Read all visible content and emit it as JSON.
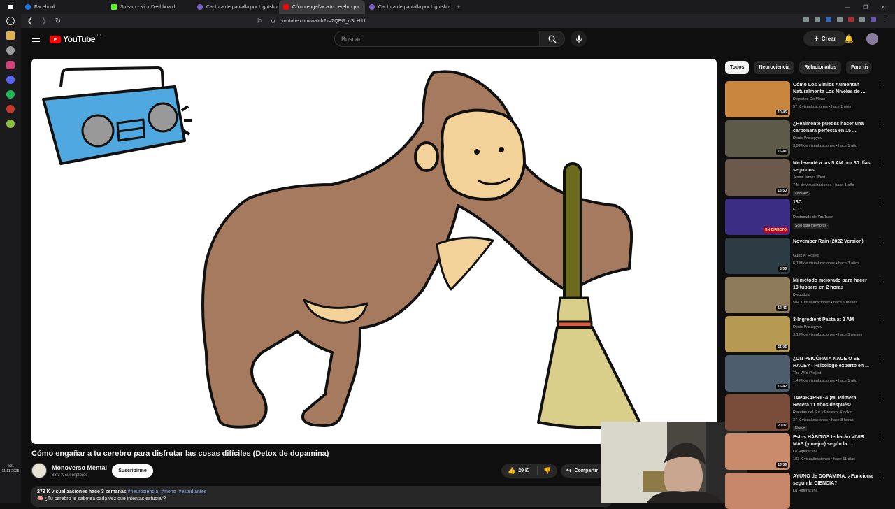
{
  "browser": {
    "tabs": [
      {
        "label": "Facebook",
        "color": "#1877f2"
      },
      {
        "label": "Stream - Kick Dashboard",
        "color": "#53fc18"
      },
      {
        "label": "Captura de pantalla por Lightshot",
        "color": "#7b61c9"
      },
      {
        "label": "Cómo engañar a tu cerebro p",
        "color": "#ff0000"
      },
      {
        "label": "Captura de pantalla por Lightshot",
        "color": "#7b61c9"
      }
    ],
    "url": "youtube.com/watch?v=ZQEG_uSLHIU",
    "new_tab": "+",
    "window_controls": [
      "—",
      "❐",
      "✕"
    ]
  },
  "system": {
    "time": "4:01",
    "date": "11-11-2025"
  },
  "youtube": {
    "logo_text": "YouTube",
    "country": "CL",
    "search_placeholder": "Buscar",
    "create_label": "Crear"
  },
  "video": {
    "title": "Cómo engañar a tu cerebro para disfrutar las cosas difíciles (Detox de dopamina)",
    "channel": "Monoverso Mental",
    "subscribers": "33,3 K suscriptores",
    "subscribe_label": "Suscribirme",
    "likes": "29 K",
    "share_label": "Compartir",
    "views_date": "273 K visualizaciones  hace 3 semanas",
    "hashtags": [
      "#neurociencia",
      "#mono",
      "#estudiantes"
    ],
    "desc_line": "🧠 ¿Tu cerebro te sabotea cada vez que intentas estudiar?"
  },
  "chips": [
    "Todos",
    "Neurociencia",
    "Relacionados",
    "Para ti"
  ],
  "recommendations": [
    {
      "title": "Cómo Los Simios Aumentan Naturalmente Los Niveles de ...",
      "channel": "Deportes De Mono",
      "meta": "57 K visualizaciones • hace 1 mes",
      "duration": "10:45",
      "thumb": "#c9863f"
    },
    {
      "title": "¿Realmente puedes hacer una carbonara perfecta en 15 ...",
      "channel": "Denis Prokopyev",
      "meta": "3,9 M de visualizaciones • hace 1 año",
      "duration": "15:41",
      "thumb": "#5d5a4a"
    },
    {
      "title": "Me levanté a las 5 AM por 30 días seguidos",
      "channel": "Jesse James West",
      "meta": "7 M de visualizaciones • hace 1 año",
      "duration": "18:50",
      "thumb": "#6b5a4c",
      "badge": "Doblado"
    },
    {
      "title": "13C",
      "channel": "El 13",
      "meta": "Destacado de YouTube",
      "duration": "EN DIRECTO",
      "thumb": "#3b2d84",
      "badge": "Solo para miembros"
    },
    {
      "title": "November Rain (2022 Version)",
      "channel": "Guns N' Roses",
      "meta": "6,7 M de visualizaciones • hace 3 años",
      "duration": "8:56",
      "thumb": "#2c3b44"
    },
    {
      "title": "Mi método mejorado para hacer 10 tuppers en 2 horas",
      "channel": "Diegodoal",
      "meta": "584 K visualizaciones • hace 6 meses",
      "duration": "12:46",
      "thumb": "#8d7b5c"
    },
    {
      "title": "3-Ingredient Pasta at 2 AM",
      "channel": "Denis Prokopyev",
      "meta": "3,1 M de visualizaciones • hace 5 meses",
      "duration": "11:05",
      "thumb": "#b69a52"
    },
    {
      "title": "¿UN PSICÓPATA NACE O SE HACE? - Psicólogo experto en ...",
      "channel": "The Wild Project",
      "meta": "1,4 M de visualizaciones • hace 1 año",
      "duration": "16:42",
      "thumb": "#4d5d6e"
    },
    {
      "title": "TAPABARRIGA ¡Mi Primera Receta 11 años después!",
      "channel": "Recetas del Sur y Profesor Klocker",
      "meta": "37 K visualizaciones • hace 8 horas",
      "duration": "20:07",
      "thumb": "#7a4d3a",
      "badge": "Nuevo"
    },
    {
      "title": "Estos HÁBITOS te harán VIVIR MÁS (y mejor) según la ...",
      "channel": "La Hiperactina",
      "meta": "183 K visualizaciones • hace 11 días",
      "duration": "16:59",
      "thumb": "#c98b6b"
    },
    {
      "title": "AYUNO de DOPAMINA: ¿Funciona según la CIENCIA?",
      "channel": "La Hiperactina",
      "meta": "",
      "duration": "",
      "thumb": "#c7866a"
    }
  ]
}
